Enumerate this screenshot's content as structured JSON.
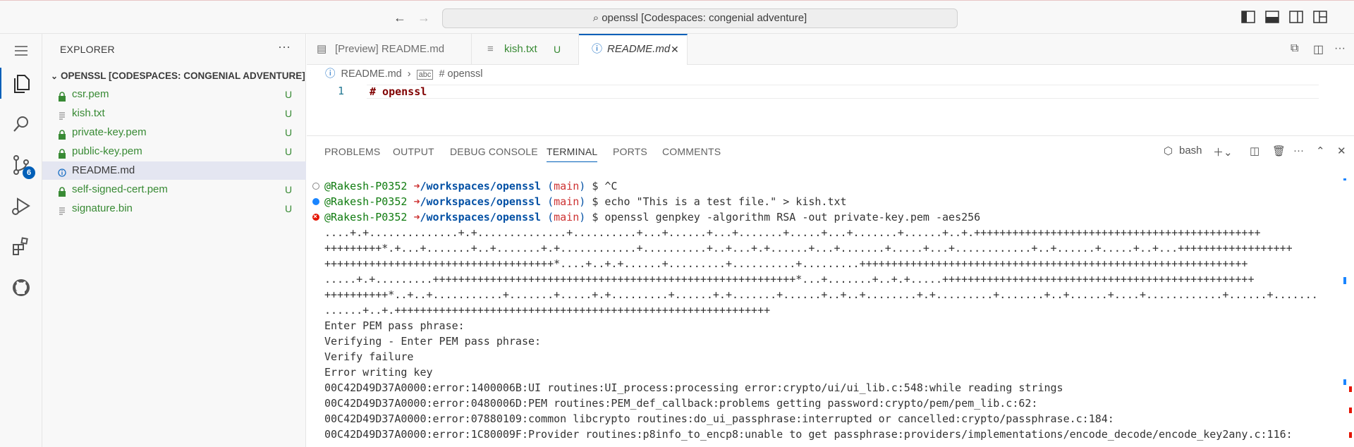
{
  "titlebar": {
    "search_text": "openssl [Codespaces: congenial adventure]",
    "back_icon": "arrow-left-icon",
    "forward_icon": "arrow-right-icon"
  },
  "activity": {
    "source_control_badge": "6"
  },
  "sidebar": {
    "title": "EXPLORER",
    "more": "···",
    "folder": "OPENSSL [CODESPACES: CONGENIAL ADVENTURE]",
    "files": [
      {
        "name": "csr.pem",
        "status": "U",
        "icon": "lock-icon"
      },
      {
        "name": "kish.txt",
        "status": "U",
        "icon": "text-file-icon"
      },
      {
        "name": "private-key.pem",
        "status": "U",
        "icon": "lock-icon"
      },
      {
        "name": "public-key.pem",
        "status": "U",
        "icon": "lock-icon"
      },
      {
        "name": "README.md",
        "status": "",
        "icon": "info-icon"
      },
      {
        "name": "self-signed-cert.pem",
        "status": "U",
        "icon": "lock-icon"
      },
      {
        "name": "signature.bin",
        "status": "U",
        "icon": "text-file-icon"
      }
    ]
  },
  "tabs": [
    {
      "label": "[Preview] README.md",
      "status": ""
    },
    {
      "label": "kish.txt",
      "status": "U"
    },
    {
      "label": "README.md",
      "status": "",
      "close": "✕"
    }
  ],
  "breadcrumb": {
    "file": "README.md",
    "symbol": "# openssl"
  },
  "editor": {
    "line_number": "1",
    "code": "# openssl"
  },
  "panel": {
    "tabs": [
      "PROBLEMS",
      "OUTPUT",
      "DEBUG CONSOLE",
      "TERMINAL",
      "PORTS",
      "COMMENTS"
    ],
    "active_tab": "TERMINAL",
    "shell": "bash"
  },
  "terminal": {
    "prompts": [
      {
        "user": "@Rakesh-P0352",
        "arrow": "➜",
        "path": "/workspaces/openssl",
        "branch": "main",
        "cmd": "$ ^C",
        "status": "default"
      },
      {
        "user": "@Rakesh-P0352",
        "arrow": "➜",
        "path": "/workspaces/openssl",
        "branch": "main",
        "cmd": "$ echo \"This is a test file.\" > kish.txt",
        "status": "success"
      },
      {
        "user": "@Rakesh-P0352",
        "arrow": "➜",
        "path": "/workspaces/openssl",
        "branch": "main",
        "cmd": "$ openssl genpkey -algorithm RSA -out private-key.pem -aes256",
        "status": "error"
      }
    ],
    "output": [
      "....+.+..............+.+..............+..........+...+......+...+.......+.....+...+.......+......+..+.+++++++++++++++++++++++++++++++++++++++++++++",
      "+++++++++*.+...+.......+..+.......+.+............+..........+..+...+.+......+...+.......+.....+...+............+..+......+.....+..+...++++++++++++++++++",
      "++++++++++++++++++++++++++++++++++++*....+..+.+......+.........+..........+.........+++++++++++++++++++++++++++++++++++++++++++++++++++++++++++++",
      ".....+.+.........+++++++++++++++++++++++++++++++++++++++++++++++++++++++++*...+.......+..+.+.....+++++++++++++++++++++++++++++++++++++++++++++++++",
      "++++++++++*..+..+...........+.......+.....+.+.........+......+.+.......+......+..+..+........+.+.........+.......+..+......+....+............+......+.......",
      "......+..+.+++++++++++++++++++++++++++++++++++++++++++++++++++++++++++",
      "Enter PEM pass phrase:",
      "Verifying - Enter PEM pass phrase:",
      "Verify failure",
      "Error writing key",
      "00C42D49D37A0000:error:1400006B:UI routines:UI_process:processing error:crypto/ui/ui_lib.c:548:while reading strings",
      "00C42D49D37A0000:error:0480006D:PEM routines:PEM_def_callback:problems getting password:crypto/pem/pem_lib.c:62:",
      "00C42D49D37A0000:error:07880109:common libcrypto routines:do_ui_passphrase:interrupted or cancelled:crypto/passphrase.c:184:",
      "00C42D49D37A0000:error:1C80009F:Provider routines:p8info_to_encp8:unable to get passphrase:providers/implementations/encode_decode/encode_key2any.c:116:"
    ]
  }
}
